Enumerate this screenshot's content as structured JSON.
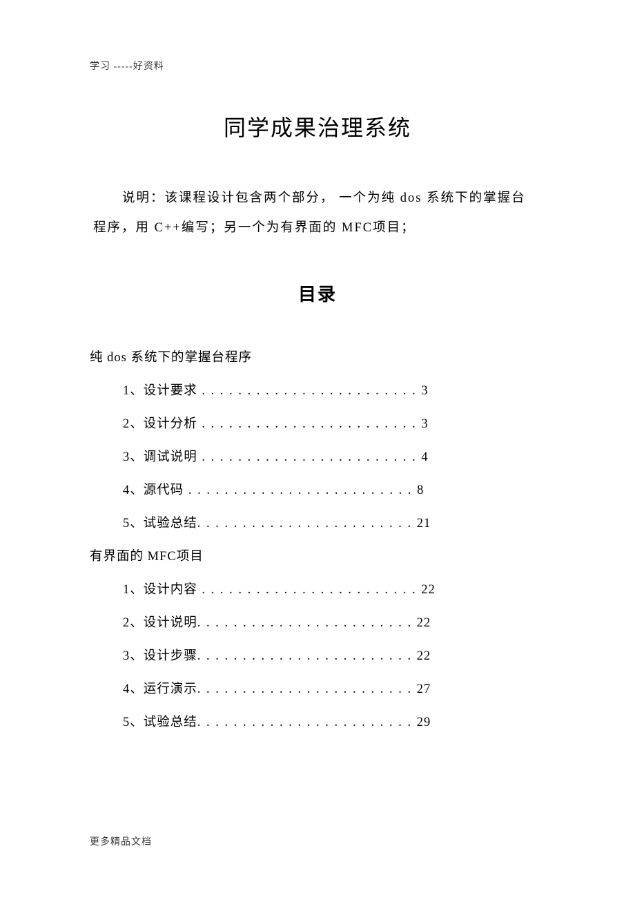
{
  "header": "学习  -----好资料",
  "main_title": "同学成果治理系统",
  "intro": {
    "line1_prefix": "说明：该课程设计包含两个部分，  一个为纯",
    "line1_mid": " dos ",
    "line1_suffix": "系统下的掌握台",
    "line2_prefix": "程序，用",
    "line2_mid1": " C++",
    "line2_mid2": "编写；另一个为有界面的   ",
    "line2_mid3": "MFC",
    "line2_suffix": "项目；"
  },
  "toc_title": "目录",
  "section1": {
    "heading_pre": "纯 ",
    "heading_mid": "dos ",
    "heading_post": "系统下的掌握台程序",
    "items": [
      {
        "num": "1",
        "label": "设计要求",
        "dots": " . . . . . . . . . . . . . . . . . . . . . . . . ",
        "page": "3"
      },
      {
        "num": "2",
        "label": "设计分析",
        "dots": " . . . . . . . . . . . . . . . . . . . . . . . . ",
        "page": "3"
      },
      {
        "num": "3",
        "label": "调试说明",
        "dots": " . . . . . . . . . . . . . . . . . . . . . . . . ",
        "page": "4"
      },
      {
        "num": "4",
        "label": "源代码",
        "dots": " . . . . . . . . . . . . . . . . . . . . . . . . . ",
        "page": "8"
      },
      {
        "num": "5",
        "label": "试验总结",
        "dots": ". . . . . . . . . . . . . . . . . . . . . . . . ",
        "page": "21"
      }
    ]
  },
  "section2": {
    "heading_pre": "有界面的 ",
    "heading_mid": "MFC",
    "heading_post": "项目",
    "items": [
      {
        "num": "1",
        "label": "设计内容",
        "dots": " . . . . . . . . . . . . . . . . . . . . . . . . ",
        "page": "22"
      },
      {
        "num": "2",
        "label": "设计说明",
        "dots": ". . . . . . . . . . . . . . . . . . . . . . . . ",
        "page": "22"
      },
      {
        "num": "3",
        "label": "设计步骤",
        "dots": ". . . . . . . . . . . . . . . . . . . . . . . . ",
        "page": "22"
      },
      {
        "num": "4",
        "label": "运行演示",
        "dots": ". . . . . . . . . . . . . . . . . . . . . . . . ",
        "page": "27"
      },
      {
        "num": "5",
        "label": "试验总结",
        "dots": ". . . . . . . . . . . . . . . . . . . . . . . . ",
        "page": "29"
      }
    ]
  },
  "footer": "更多精品文档"
}
